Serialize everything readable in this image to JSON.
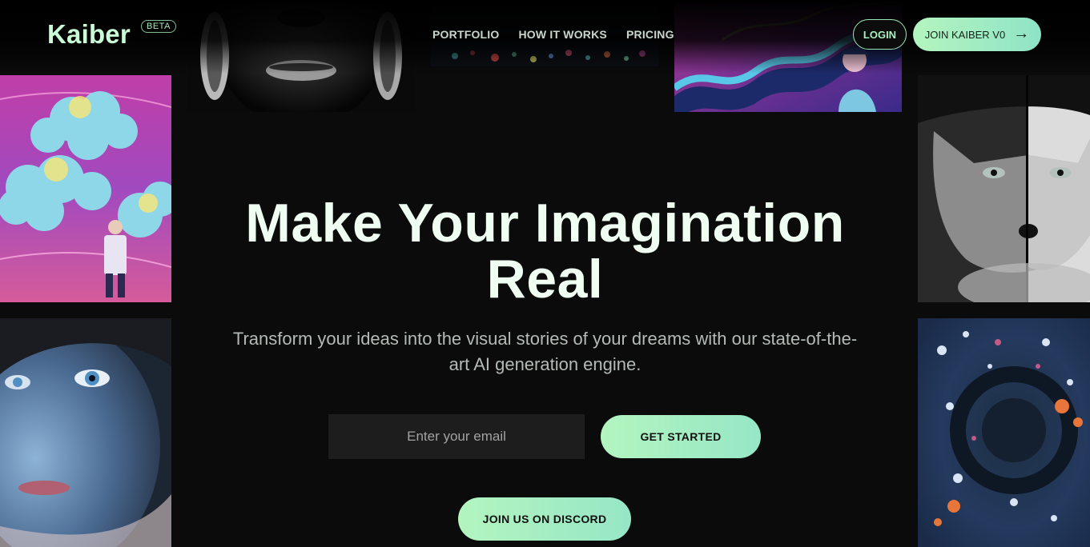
{
  "header": {
    "logo": "Kaiber",
    "badge": "BETA",
    "nav": [
      {
        "label": "PORTFOLIO"
      },
      {
        "label": "HOW IT WORKS"
      },
      {
        "label": "PRICING"
      }
    ],
    "login_label": "LOGIN",
    "join_label": "JOIN KAIBER V0",
    "join_icon": "arrow-right-icon"
  },
  "hero": {
    "title": "Make Your Imagination Real",
    "subtitle": "Transform your ideas into the visual stories of your dreams with our state-of-the-art AI generation engine.",
    "email_placeholder": "Enter your email",
    "cta_label": "GET STARTED",
    "discord_label": "JOIN US ON DISCORD"
  },
  "colors": {
    "background": "#0b0b0b",
    "accent_start": "#b3f5bf",
    "accent_end": "#96e6c7",
    "title": "#effff2",
    "subtitle": "#b4bab6"
  }
}
